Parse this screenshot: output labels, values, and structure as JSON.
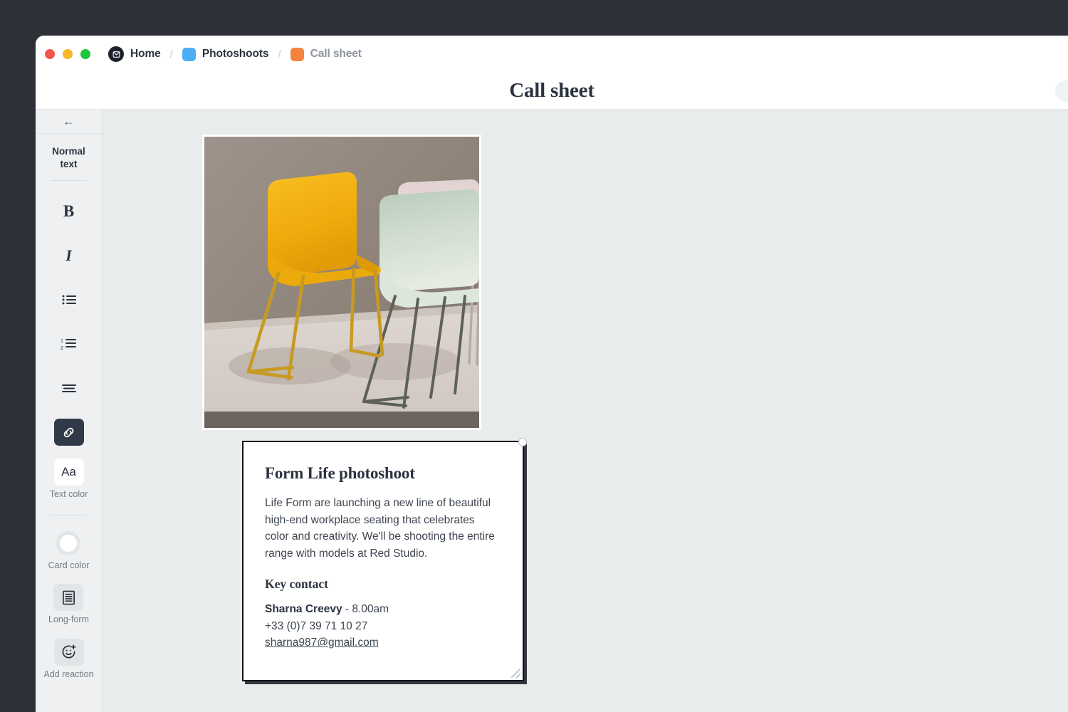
{
  "window": {
    "traffic_lights": [
      {
        "name": "close",
        "color": "#f2564d"
      },
      {
        "name": "minimize",
        "color": "#f4b82a"
      },
      {
        "name": "maximize",
        "color": "#1fc43a"
      }
    ]
  },
  "breadcrumb": {
    "separator": "/",
    "items": [
      {
        "label": "Home",
        "icon": "home-mark-icon",
        "icon_color": "#1c212b",
        "muted": false
      },
      {
        "label": "Photoshoots",
        "icon": "blue-square-icon",
        "icon_color": "#4daef5",
        "muted": false
      },
      {
        "label": "Call sheet",
        "icon": "orange-square-icon",
        "icon_color": "#f5833f",
        "muted": true
      }
    ]
  },
  "doc_header": {
    "title": "Call sheet"
  },
  "toolbar": {
    "back_arrow": "←",
    "style_label": "Normal\ntext",
    "style_label_line1": "Normal",
    "style_label_line2": "text",
    "items": [
      {
        "name": "bold",
        "glyph": "B",
        "caption": ""
      },
      {
        "name": "italic",
        "glyph": "I",
        "caption": ""
      },
      {
        "name": "bulleted-list",
        "glyph": "",
        "caption": ""
      },
      {
        "name": "numbered-list",
        "glyph": "",
        "caption": ""
      },
      {
        "name": "align",
        "glyph": "",
        "caption": ""
      },
      {
        "name": "link",
        "glyph": "",
        "caption": "",
        "active": true
      },
      {
        "name": "text-color",
        "glyph": "Aa",
        "caption": "Text color"
      },
      {
        "name": "card-color",
        "glyph": "",
        "caption": "Card color"
      },
      {
        "name": "long-form",
        "glyph": "",
        "caption": "Long-form"
      },
      {
        "name": "add-reaction",
        "glyph": "",
        "caption": "Add reaction"
      }
    ],
    "captions": {
      "text_color": "Text color",
      "card_color": "Card color",
      "long_form": "Long-form",
      "add_reaction": "Add reaction"
    }
  },
  "canvas": {
    "photo": {
      "alt": "Three modern sled-base chairs in a studio: a yellow chair in front, a mint green chair and a pale pink chair behind, against a warm grey concrete wall",
      "colors": {
        "wall": "#9a8f88",
        "floor": "#d9d1cb",
        "yellow_chair": "#f2b115",
        "mint_chair": "#cfdcd0",
        "pink_chair": "#e2d3d3"
      }
    },
    "card": {
      "title": "Form Life photoshoot",
      "body": "Life Form are launching a new line of beautiful high-end workplace seating that celebrates color and creativity. We'll be shooting the entire range with models at Red Studio.",
      "contact_heading": "Key contact",
      "contact_name": "Sharna Creevy",
      "contact_time": " - 8.00am",
      "contact_phone": "+33 (0)7 39 71 10 27",
      "contact_email": "sharna987@gmail.com"
    }
  }
}
